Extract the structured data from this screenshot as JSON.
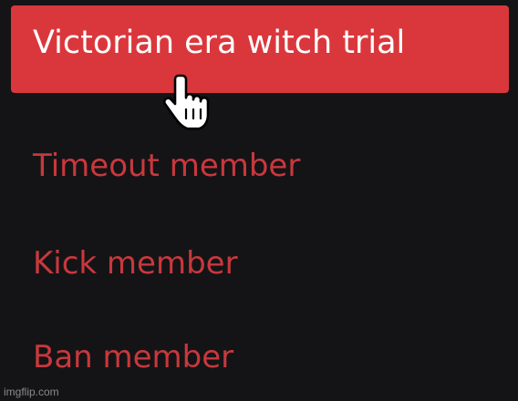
{
  "context_menu": {
    "items": [
      {
        "label": "Victorian era witch trial",
        "state": "highlighted"
      },
      {
        "label": "Timeout member",
        "state": "danger"
      },
      {
        "label": "Kick member",
        "state": "danger"
      },
      {
        "label": "Ban member",
        "state": "danger"
      }
    ]
  },
  "cursor": {
    "icon": "hand-pointer-icon"
  },
  "watermark": {
    "text": "imgflip.com"
  },
  "colors": {
    "background": "#141416",
    "highlight": "#da373c",
    "danger_text": "#c8383d",
    "highlight_text": "#ffffff"
  }
}
